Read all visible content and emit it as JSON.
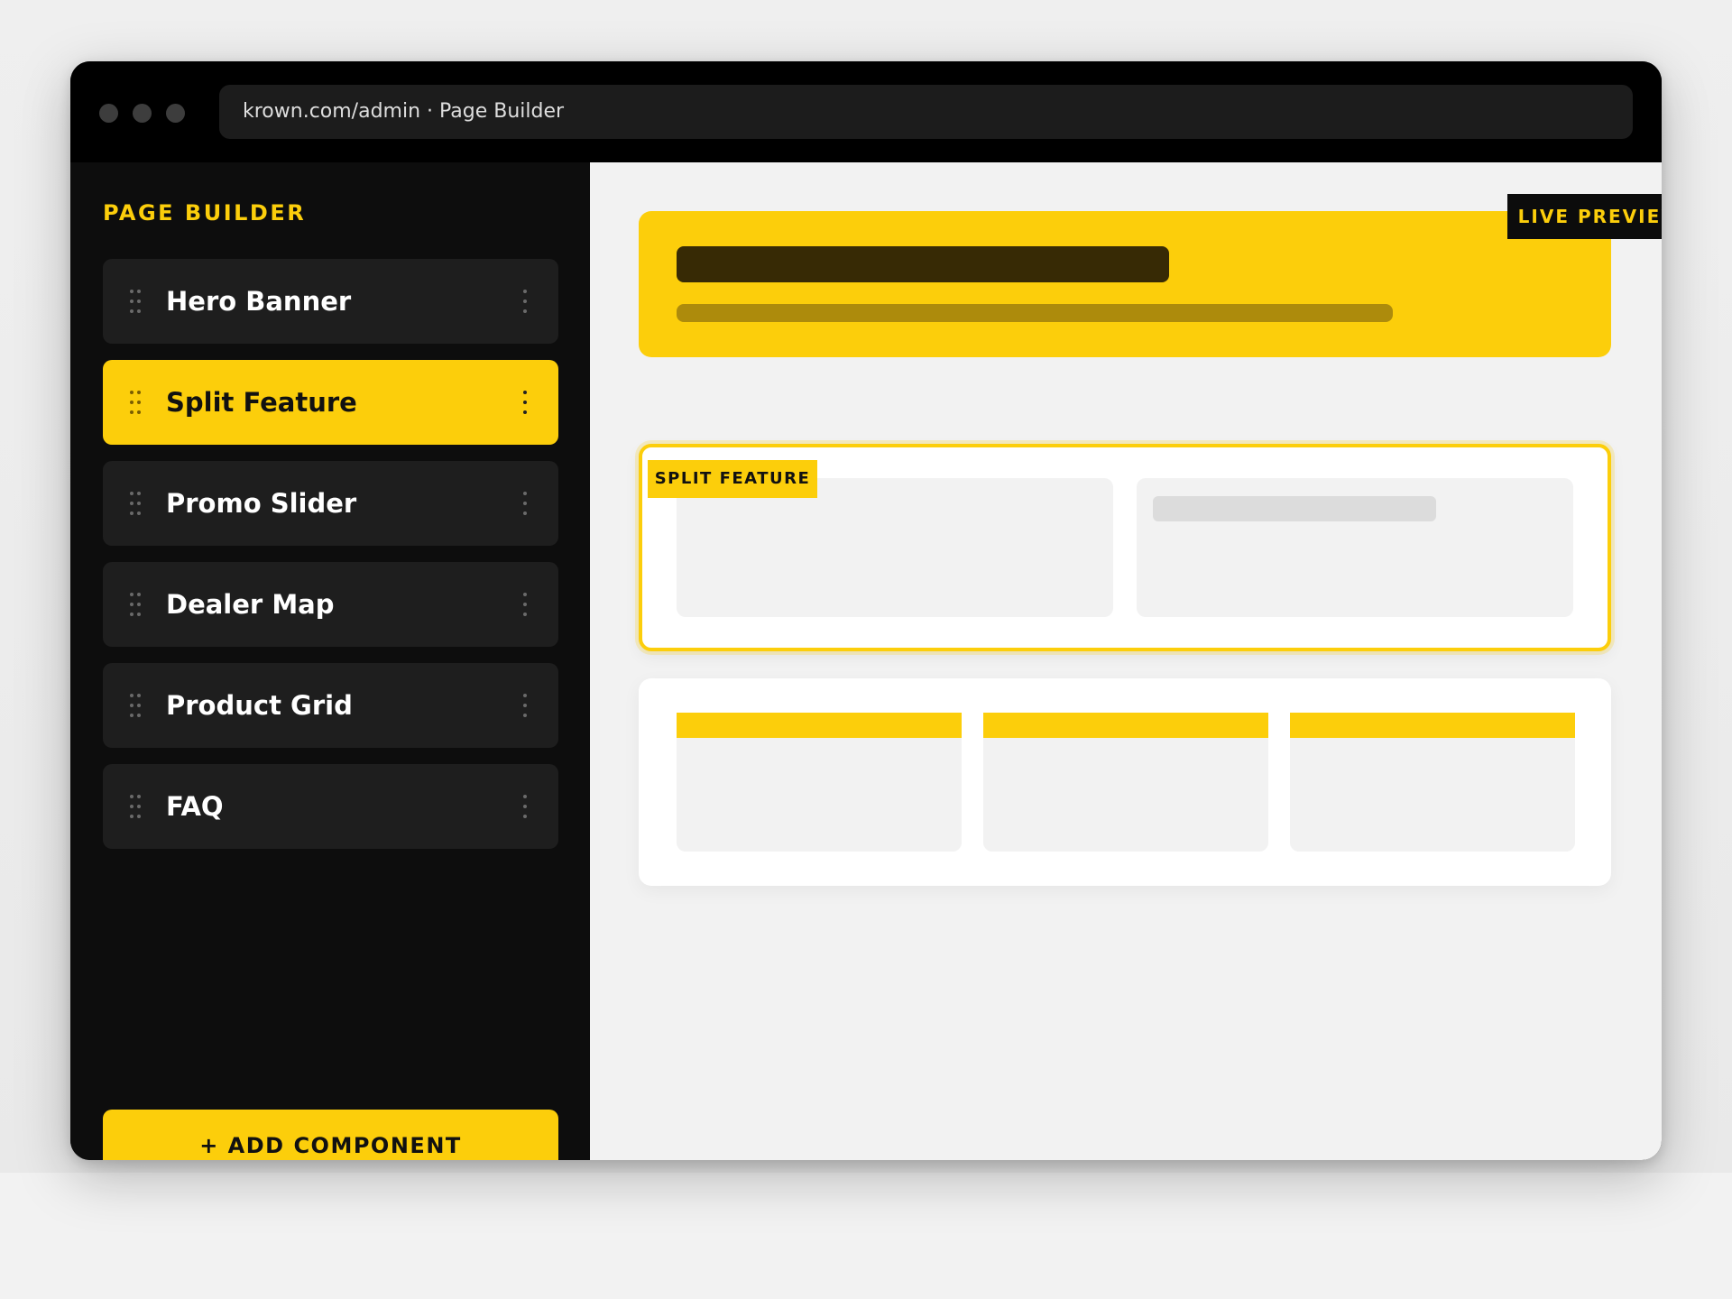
{
  "window": {
    "url": "krown.com/admin · Page Builder"
  },
  "sidebar": {
    "title": "PAGE BUILDER",
    "items": [
      {
        "label": "Hero Banner",
        "active": false
      },
      {
        "label": "Split Feature",
        "active": true
      },
      {
        "label": "Promo Slider",
        "active": false
      },
      {
        "label": "Dealer Map",
        "active": false
      },
      {
        "label": "Product Grid",
        "active": false
      },
      {
        "label": "FAQ",
        "active": false
      }
    ],
    "add_button": "+ ADD COMPONENT"
  },
  "preview": {
    "badge": "LIVE PREVIEW",
    "selected_tag": "SPLIT FEATURE"
  },
  "colors": {
    "accent": "#fcce0b",
    "sidebar_bg": "#0d0d0d",
    "item_bg": "#1e1e1e",
    "canvas_bg": "#f2f2f2"
  },
  "icons": {
    "drag": "drag-handle-icon",
    "menu": "more-vertical-icon"
  }
}
